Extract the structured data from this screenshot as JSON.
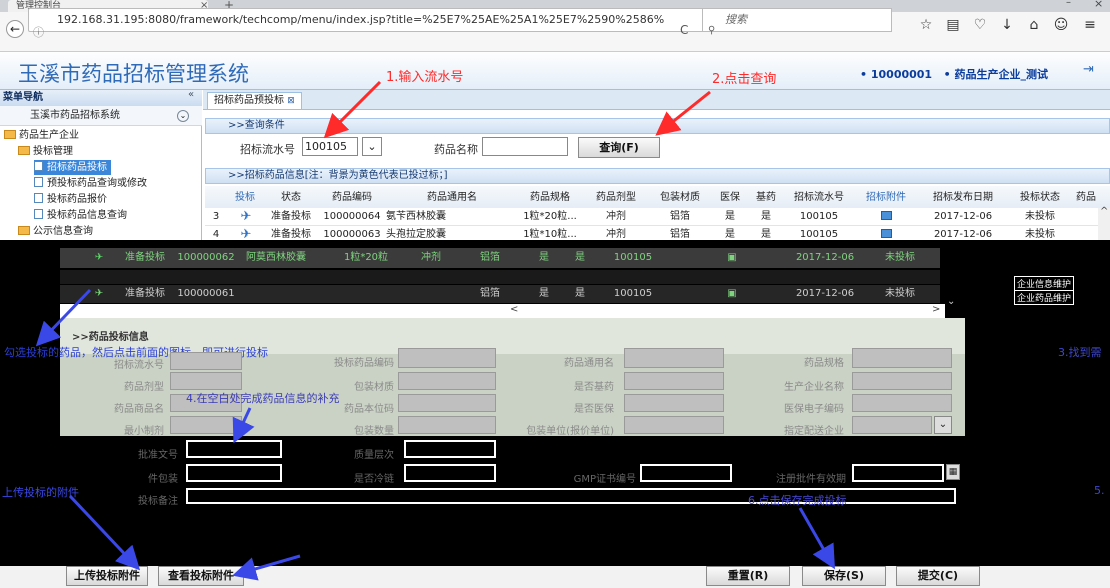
{
  "browser": {
    "tab_title": "管理控制台",
    "url": "192.168.31.195:8080/framework/techcomp/menu/index.jsp?title=%25E7%25AE%25A1%25E7%2590%2586%",
    "search_placeholder": "搜索"
  },
  "app": {
    "title": "玉溪市药品招标管理系统",
    "user_id": "• 10000001",
    "user_name": "• 药品生产企业_测试"
  },
  "annotations": {
    "step1": "1.输入流水号",
    "step2": "2.点击查询",
    "step3": "3.找到需",
    "step4": "4.在空白处完成药品信息的补充",
    "step5": "5.",
    "step6": "6.点击保存完成投标",
    "select_tip": "勾选投标的药品，然后点击前面的图标，即可进行投标",
    "upload_tip": "上传投标的附件"
  },
  "sidebar": {
    "header": "菜单导航",
    "system": "玉溪市药品招标系统",
    "items": [
      {
        "label": "药品生产企业",
        "type": "folder"
      },
      {
        "label": "投标管理",
        "type": "folder"
      },
      {
        "label": "招标药品投标",
        "type": "doc"
      },
      {
        "label": "预投标药品查询或修改",
        "type": "doc"
      },
      {
        "label": "投标药品报价",
        "type": "doc"
      },
      {
        "label": "投标药品信息查询",
        "type": "doc"
      },
      {
        "label": "公示信息查询",
        "type": "folder"
      }
    ],
    "overlay_items": [
      "企业信息维护",
      "企业药品维护"
    ]
  },
  "main": {
    "tab_label": "招标药品预投标",
    "query": {
      "header": ">>查询条件",
      "serial_label": "招标流水号",
      "serial_value": "100105",
      "drug_name_label": "药品名称",
      "drug_name_value": "",
      "query_button": "查询(F)"
    },
    "info_header": ">>招标药品信息[注：背景为黄色代表已投过标；]",
    "columns": [
      "投标",
      "状态",
      "药品编码",
      "药品通用名",
      "药品规格",
      "药品剂型",
      "包装材质",
      "医保",
      "基药",
      "招标流水号",
      "招标附件",
      "招标发布日期",
      "投标状态",
      "药品"
    ],
    "rows": [
      {
        "num": "3",
        "status": "准备投标",
        "code": "100000064",
        "name": "氨苄西林胶囊",
        "spec": "1粒*20粒...",
        "form": "冲剂",
        "pack": "铝箔",
        "ins": "是",
        "base": "是",
        "serial": "100105",
        "date": "2017-12-06",
        "bid": "未投标"
      },
      {
        "num": "4",
        "status": "准备投标",
        "code": "100000063",
        "name": "头孢拉定胶囊",
        "spec": "1粒*10粒...",
        "form": "冲剂",
        "pack": "铝箔",
        "ins": "是",
        "base": "是",
        "serial": "100105",
        "date": "2017-12-06",
        "bid": "未投标"
      },
      {
        "num": "",
        "status": "准备投标",
        "code": "100000062",
        "name": "阿莫西林胶囊",
        "spec": "1粒*20粒",
        "form": "冲剂",
        "pack": "铝箔",
        "ins": "是",
        "base": "是",
        "serial": "100105",
        "date": "2017-12-06",
        "bid": "未投标"
      },
      {
        "num": "",
        "status": "",
        "code": "",
        "name": "",
        "spec": "",
        "form": "",
        "pack": "",
        "ins": "",
        "base": "",
        "serial": "",
        "date": "",
        "bid": ""
      },
      {
        "num": "",
        "status": "准备投标",
        "code": "100000061",
        "name": "",
        "spec": "",
        "form": "",
        "pack": "铝箔",
        "ins": "是",
        "base": "是",
        "serial": "100105",
        "date": "2017-12-06",
        "bid": "未投标"
      }
    ],
    "form_header": ">>药品投标信息",
    "form_labels": {
      "serial": "招标流水号",
      "bid_code": "投标药品编码",
      "generic": "药品通用名",
      "spec": "药品规格",
      "form": "药品剂型",
      "pack": "包装材质",
      "base": "是否基药",
      "maker": "生产企业名称",
      "trade": "药品商品名",
      "local_code": "药品本位码",
      "ins": "是否医保",
      "ins_code": "医保电子编码",
      "min_unit": "最小制剂",
      "pack_qty": "包装数量",
      "pack_unit": "包装单位(报价单位)",
      "dist": "指定配送企业",
      "approval": "批准文号",
      "quality": "质量层次",
      "big_pack": "件包装",
      "cold": "是否冷链",
      "gmp": "GMP证书编号",
      "reg_valid": "注册批件有效期",
      "remark": "投标备注"
    },
    "buttons": {
      "upload": "上传投标附件",
      "view": "查看投标附件",
      "reset": "重置(R)",
      "save": "保存(S)",
      "submit": "提交(C)"
    }
  }
}
